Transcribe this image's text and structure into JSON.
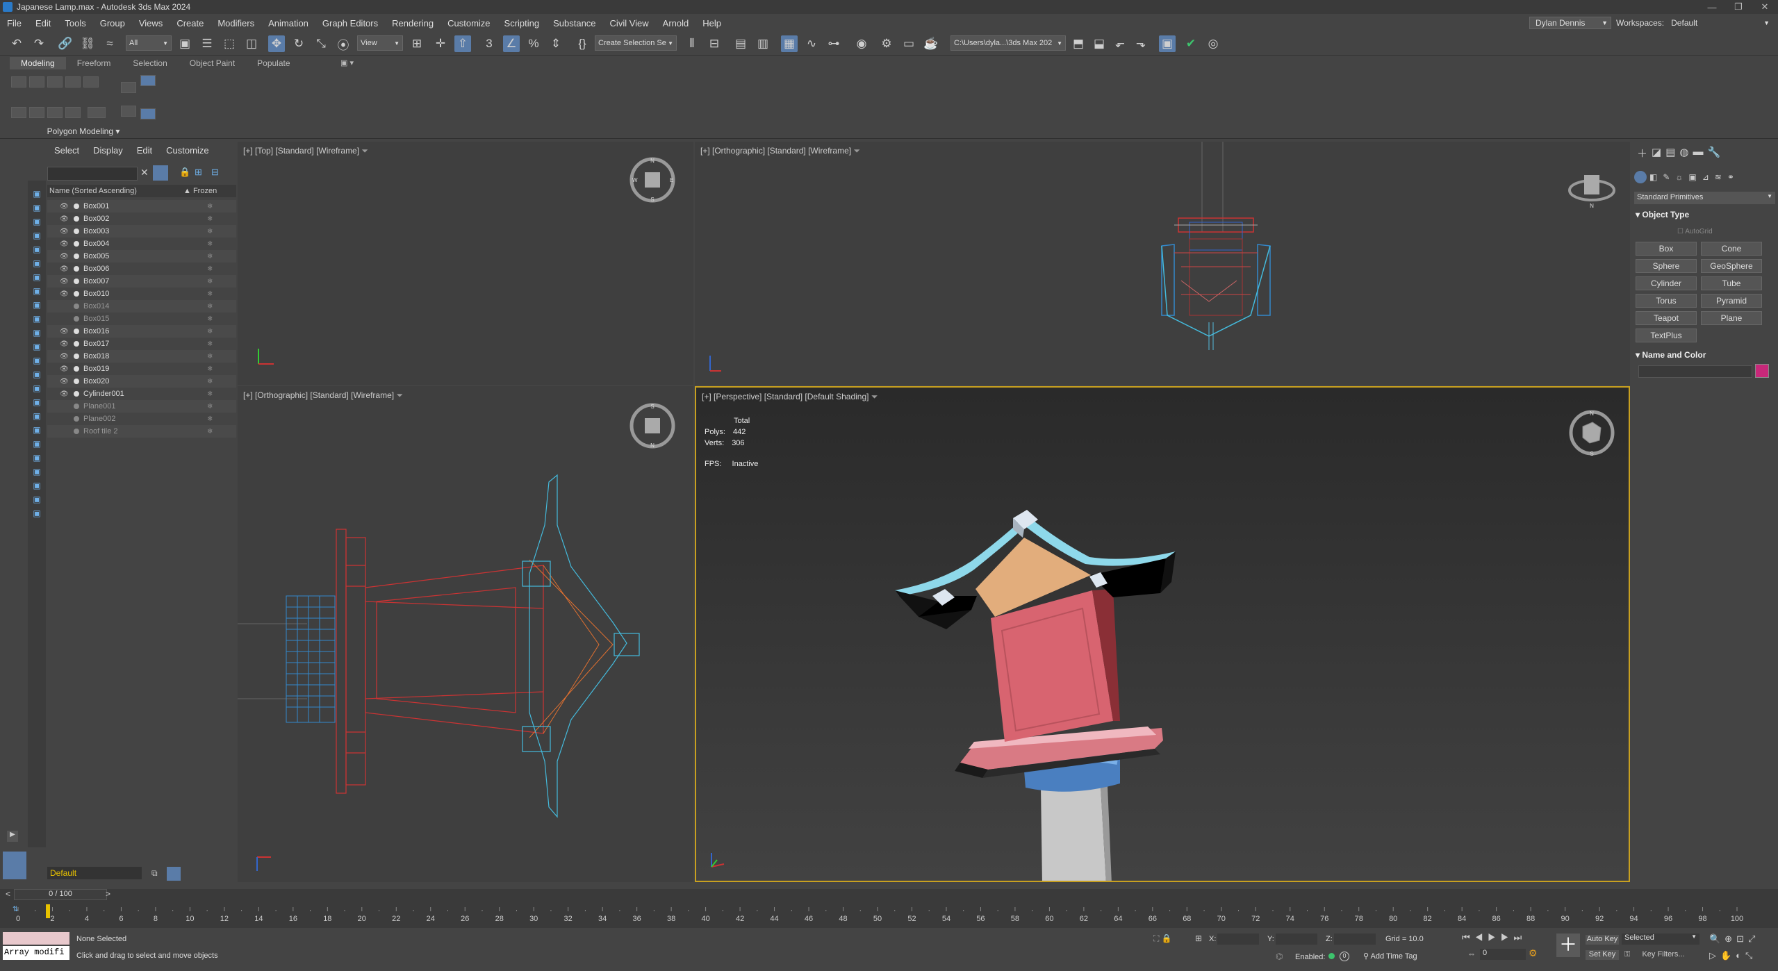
{
  "window": {
    "title": "Japanese Lamp.max - Autodesk 3ds Max 2024",
    "minimize": "—",
    "restore": "❐",
    "close": "✕"
  },
  "menu": [
    "File",
    "Edit",
    "Tools",
    "Group",
    "Views",
    "Create",
    "Modifiers",
    "Animation",
    "Graph Editors",
    "Rendering",
    "Customize",
    "Scripting",
    "Substance",
    "Civil View",
    "Arnold",
    "Help"
  ],
  "user": {
    "name": "Dylan Dennis",
    "workspaces_label": "Workspaces:",
    "workspace": "Default"
  },
  "toolbar": {
    "filter": "All",
    "refcoord": "View",
    "selection_set": "Create Selection Se",
    "path": "C:\\Users\\dyla...\\3ds Max 202"
  },
  "ribbon": {
    "tabs": [
      "Modeling",
      "Freeform",
      "Selection",
      "Object Paint",
      "Populate"
    ],
    "active": "Modeling",
    "panel": "Polygon Modeling"
  },
  "scene_explorer": {
    "menu": [
      "Select",
      "Display",
      "Edit",
      "Customize"
    ],
    "col_name": "Name (Sorted Ascending)",
    "col_frozen": "Frozen",
    "items": [
      {
        "name": "Box001",
        "dim": false,
        "eye": true
      },
      {
        "name": "Box002",
        "dim": false,
        "eye": true
      },
      {
        "name": "Box003",
        "dim": false,
        "eye": true
      },
      {
        "name": "Box004",
        "dim": false,
        "eye": true
      },
      {
        "name": "Box005",
        "dim": false,
        "eye": true
      },
      {
        "name": "Box006",
        "dim": false,
        "eye": true
      },
      {
        "name": "Box007",
        "dim": false,
        "eye": true
      },
      {
        "name": "Box010",
        "dim": false,
        "eye": true
      },
      {
        "name": "Box014",
        "dim": true,
        "eye": false
      },
      {
        "name": "Box015",
        "dim": true,
        "eye": false
      },
      {
        "name": "Box016",
        "dim": false,
        "eye": true
      },
      {
        "name": "Box017",
        "dim": false,
        "eye": true
      },
      {
        "name": "Box018",
        "dim": false,
        "eye": true
      },
      {
        "name": "Box019",
        "dim": false,
        "eye": true
      },
      {
        "name": "Box020",
        "dim": false,
        "eye": true
      },
      {
        "name": "Cylinder001",
        "dim": false,
        "eye": true
      },
      {
        "name": "Plane001",
        "dim": true,
        "eye": false
      },
      {
        "name": "Plane002",
        "dim": true,
        "eye": false
      },
      {
        "name": "Roof tile 2",
        "dim": true,
        "eye": false
      }
    ],
    "layer": "Default"
  },
  "viewports": {
    "top": "[+] [Top] [Standard] [Wireframe]",
    "ortho1": "[+] [Orthographic] [Standard] [Wireframe]",
    "ortho2": "[+] [Orthographic] [Standard] [Wireframe]",
    "persp": "[+] [Perspective] [Standard] [Default Shading]",
    "stats": {
      "total": "Total",
      "polys_label": "Polys:",
      "polys": "442",
      "verts_label": "Verts:",
      "verts": "306",
      "fps_label": "FPS:",
      "fps": "Inactive"
    }
  },
  "command_panel": {
    "dropdown": "Standard Primitives",
    "rollout_object_type": "Object Type",
    "autogrid": "AutoGrid",
    "buttons": [
      "Box",
      "Cone",
      "Sphere",
      "GeoSphere",
      "Cylinder",
      "Tube",
      "Torus",
      "Pyramid",
      "Teapot",
      "Plane",
      "TextPlus"
    ],
    "rollout_name_color": "Name and Color",
    "object_color": "#c8287a"
  },
  "timeline": {
    "frame": "0 / 100",
    "ticks": [
      "0",
      "2",
      "4",
      "6",
      "8",
      "10",
      "12",
      "14",
      "16",
      "18",
      "20",
      "22",
      "24",
      "26",
      "28",
      "30",
      "32",
      "34",
      "36",
      "38",
      "40",
      "42",
      "44",
      "46",
      "48",
      "50",
      "52",
      "54",
      "56",
      "58",
      "60",
      "62",
      "64",
      "66",
      "68",
      "70",
      "72",
      "74",
      "76",
      "78",
      "80",
      "82",
      "84",
      "86",
      "88",
      "90",
      "92",
      "94",
      "96",
      "98",
      "100"
    ]
  },
  "status": {
    "maxscript": "Array modifi",
    "selection": "None Selected",
    "prompt": "Click and drag to select and move objects",
    "x_label": "X:",
    "y_label": "Y:",
    "z_label": "Z:",
    "grid": "Grid = 10.0",
    "enabled": "Enabled:",
    "add_time_tag": "Add Time Tag",
    "auto_key": "Auto Key",
    "selected": "Selected",
    "set_key": "Set Key",
    "key_filters": "Key Filters...",
    "frame_value": "0"
  }
}
